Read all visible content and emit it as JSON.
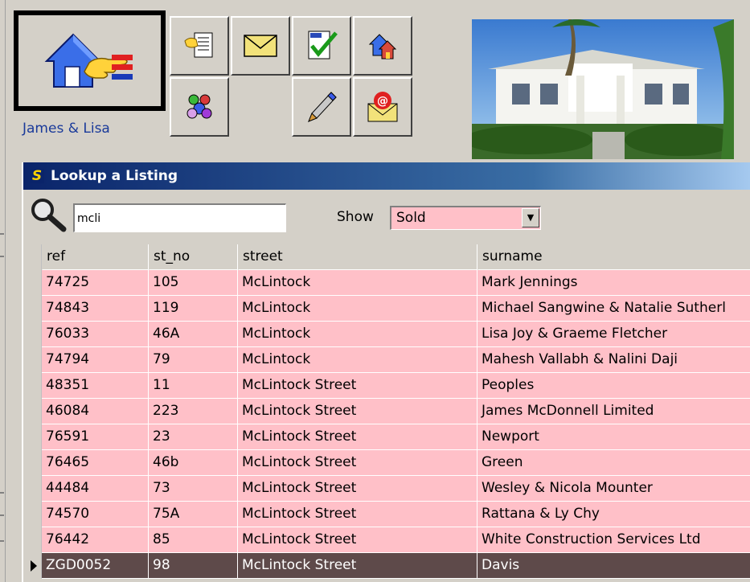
{
  "toolbar": {
    "user_name": "James & Lisa",
    "buttons": [
      {
        "icon": "documents-icon"
      },
      {
        "icon": "envelope-icon"
      },
      {
        "icon": "todo-checklist-icon"
      },
      {
        "icon": "houses-icon"
      },
      {
        "icon": "people-group-icon"
      },
      {
        "icon": "pen-icon"
      },
      {
        "icon": "email-at-icon"
      }
    ]
  },
  "dialog": {
    "title": "Lookup a Listing",
    "app_icon_letter": "S",
    "search_value": "mcli",
    "show_label": "Show",
    "show_value": "Sold",
    "columns": [
      "ref",
      "st_no",
      "street",
      "surname"
    ],
    "rows": [
      {
        "ref": "74725",
        "st_no": "105",
        "street": "McLintock",
        "surname": "Mark Jennings"
      },
      {
        "ref": "74843",
        "st_no": "119",
        "street": "McLintock",
        "surname": "Michael Sangwine & Natalie Sutherl"
      },
      {
        "ref": "76033",
        "st_no": "46A",
        "street": "McLintock",
        "surname": "Lisa Joy  & Graeme Fletcher"
      },
      {
        "ref": "74794",
        "st_no": "79",
        "street": "McLintock",
        "surname": "Mahesh Vallabh & Nalini Daji"
      },
      {
        "ref": "48351",
        "st_no": "11",
        "street": "McLintock Street",
        "surname": "Peoples"
      },
      {
        "ref": "46084",
        "st_no": "223",
        "street": "McLintock Street",
        "surname": "James McDonnell Limited"
      },
      {
        "ref": "76591",
        "st_no": "23",
        "street": "McLintock Street",
        "surname": "Newport"
      },
      {
        "ref": "76465",
        "st_no": "46b",
        "street": "McLintock Street",
        "surname": "Green"
      },
      {
        "ref": "44484",
        "st_no": "73",
        "street": "McLintock Street",
        "surname": "Wesley & Nicola Mounter"
      },
      {
        "ref": "74570",
        "st_no": "75A",
        "street": "McLintock Street",
        "surname": "Rattana & Ly Chy"
      },
      {
        "ref": "76442",
        "st_no": "85",
        "street": "McLintock Street",
        "surname": "White Construction Services Ltd"
      },
      {
        "ref": "ZGD0052",
        "st_no": "98",
        "street": "McLintock Street",
        "surname": "Davis",
        "selected": true
      }
    ]
  },
  "colors": {
    "row_bg": "#ffc0c8",
    "selected_row_bg": "#5e4a4a",
    "title_bar": "#0a246a",
    "user_label": "#1a3a9a"
  }
}
